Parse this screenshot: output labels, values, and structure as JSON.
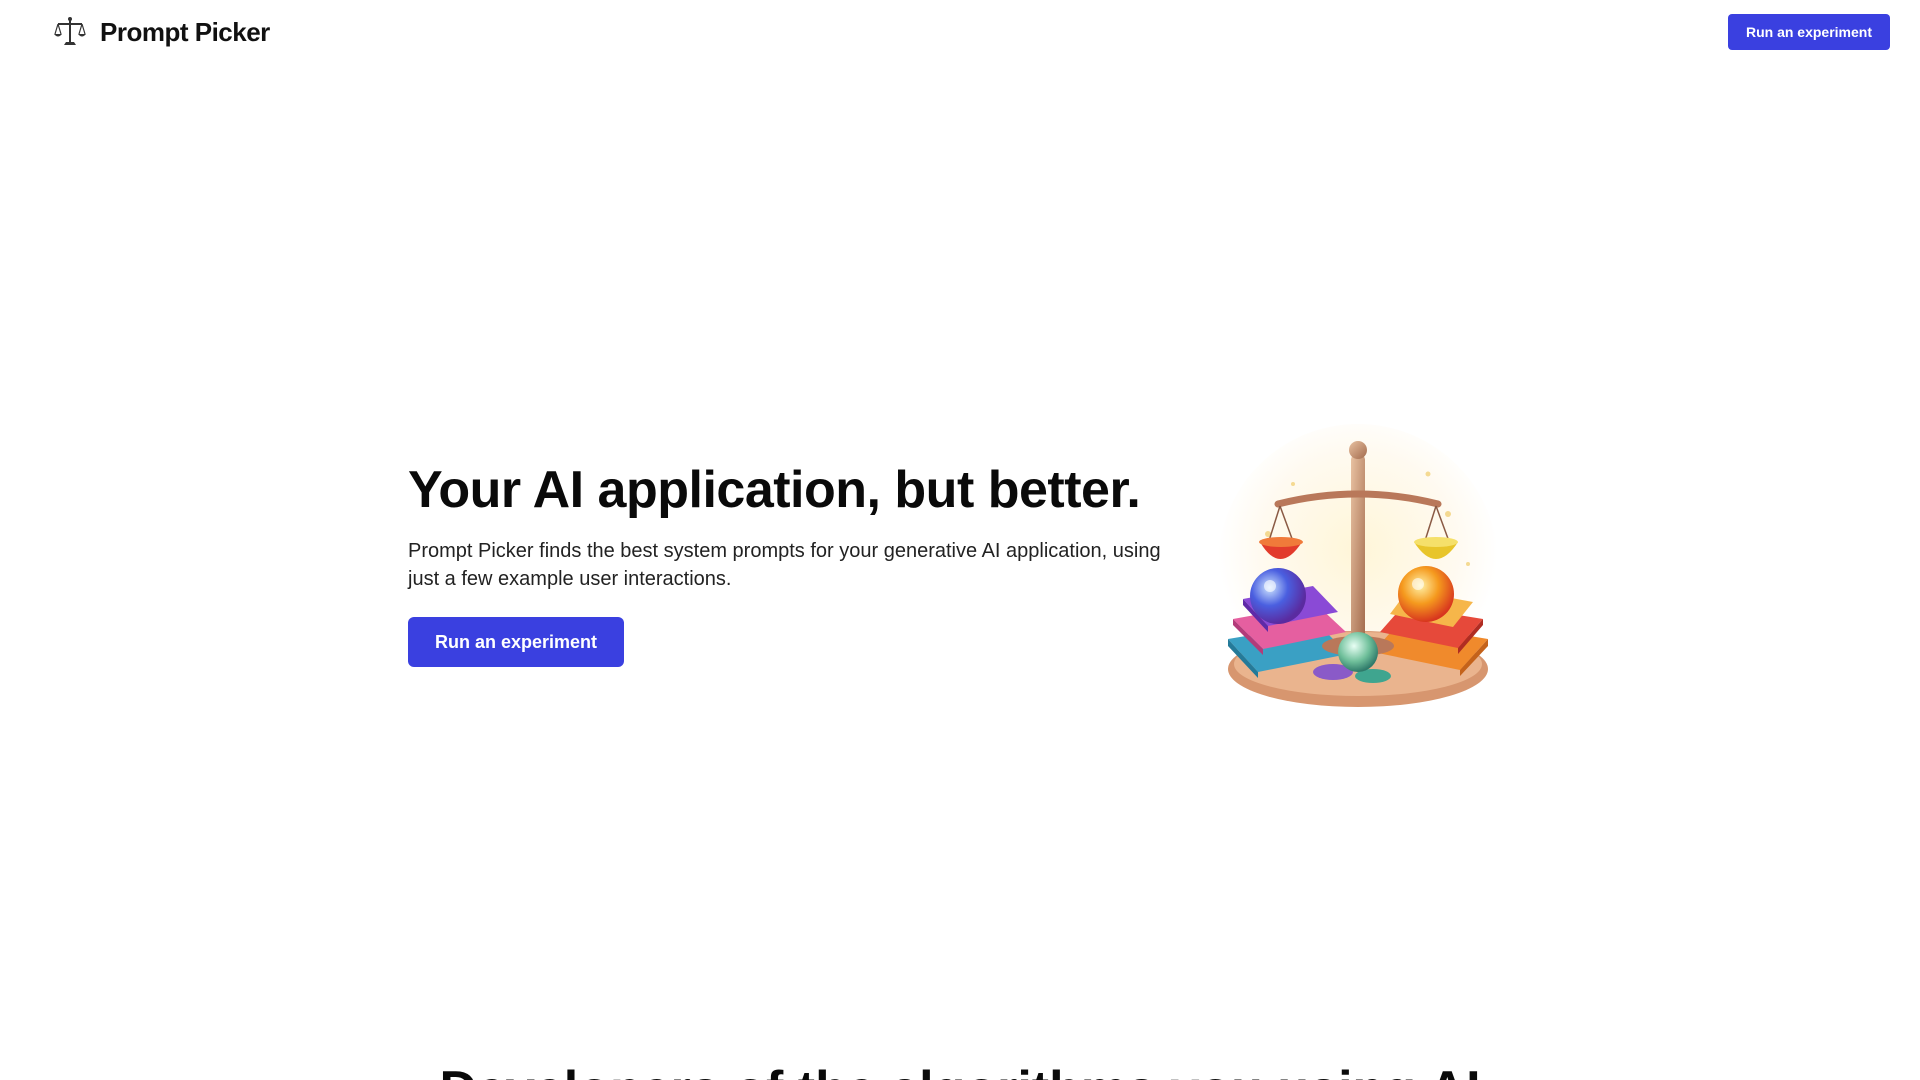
{
  "header": {
    "brand_name": "Prompt Picker",
    "brand_icon": "scales-icon",
    "cta_label": "Run an experiment"
  },
  "hero": {
    "title": "Your AI application, but better.",
    "subtitle": "Prompt Picker finds the best system prompts for your generative AI application, using just a few example user interactions.",
    "cta_label": "Run an experiment",
    "illustration": "scales-of-justice-illustration"
  },
  "next_section": {
    "heading_partial": "Developers of the algorithms you using AI"
  },
  "colors": {
    "accent": "#3a40e0",
    "text": "#0a0a0a",
    "background": "#ffffff"
  }
}
